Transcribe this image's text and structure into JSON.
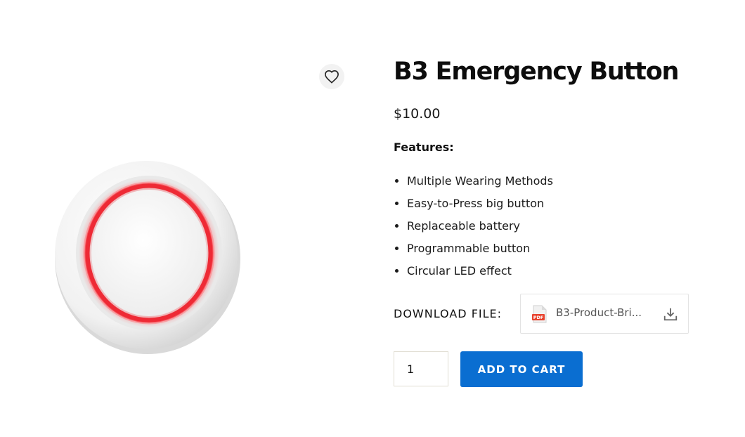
{
  "product": {
    "title": "B3 Emergency Button",
    "price": "$10.00",
    "features_label": "Features:",
    "features": [
      "Multiple Wearing Methods",
      "Easy-to-Press big button",
      "Replaceable battery",
      "Programmable button",
      "Circular LED effect"
    ],
    "image_icon": "emergency-button-photo"
  },
  "wishlist": {
    "icon": "heart-icon"
  },
  "download": {
    "label": "DOWNLOAD FILE:",
    "file_name": "B3-Product-Bri...",
    "file_icon": "pdf-icon",
    "file_icon_text": "PDF",
    "action_icon": "download-icon"
  },
  "cart": {
    "quantity": "1",
    "button_label": "ADD TO CART"
  },
  "colors": {
    "accent": "#0a6ed1",
    "led_red": "#ee2a35",
    "pdf_red": "#e8422e"
  }
}
